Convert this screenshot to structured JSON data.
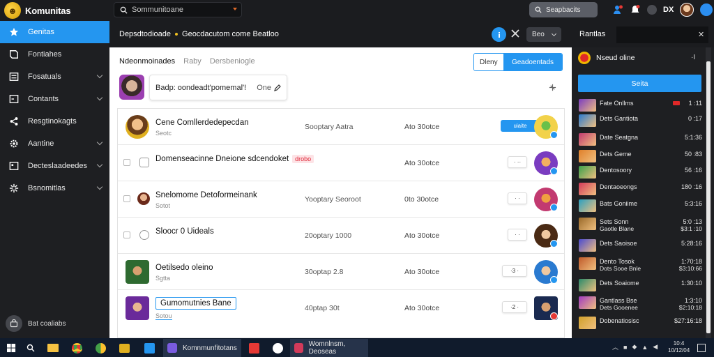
{
  "app": {
    "title": "Komunitas"
  },
  "search": {
    "placeholder": "Sommunitoane"
  },
  "top_search_button": "Seapbacits",
  "top_icons": [
    "profile-alert-icon",
    "notifications-icon",
    "status-dot-icon",
    "dx-label",
    "user-avatar",
    "account-icon"
  ],
  "top_dx": "DX",
  "sidebar": {
    "items": [
      {
        "label": "Genitas",
        "icon": "star-icon",
        "active": true,
        "chevron": false
      },
      {
        "label": "Fontiahes",
        "icon": "book-icon",
        "active": false,
        "chevron": false
      },
      {
        "label": "Fosatuals",
        "icon": "list-icon",
        "active": false,
        "chevron": true
      },
      {
        "label": "Contants",
        "icon": "inbox-icon",
        "active": false,
        "chevron": true
      },
      {
        "label": "Resgtinokagts",
        "icon": "share-icon",
        "active": false,
        "chevron": false
      },
      {
        "label": "Aantine",
        "icon": "gear-icon",
        "active": false,
        "chevron": true
      },
      {
        "label": "Decteslaadeedes",
        "icon": "grid-icon",
        "active": false,
        "chevron": true
      },
      {
        "label": "Bsnomitlas",
        "icon": "puzzle-icon",
        "active": false,
        "chevron": true
      }
    ],
    "footer": {
      "label": "Bat coaliabs",
      "icon": "bag-icon"
    }
  },
  "main_header": {
    "crumb_a": "Depsdtodioade",
    "crumb_b": "Geocdacutom come Beatloo",
    "tools_icon": "tools-icon",
    "dropdown": "Beo"
  },
  "main": {
    "subtabs": [
      "Ndeonmoinades",
      "Raby",
      "Dersbeniogle"
    ],
    "segment": {
      "left": "Dleny",
      "right": "Geadoentads"
    },
    "compose": {
      "text": "Badp: oondeadt'pomemal'!",
      "meta": "One"
    },
    "rows": [
      {
        "title": "Cene Comllerdedepecdan",
        "sub": "Seotc",
        "col2": "Sooptary Aatra",
        "col3": "Ato 30otce",
        "pill": "uiaite",
        "tag": ""
      },
      {
        "title": "Domenseacinne Dneione sdcendoket",
        "sub": "",
        "col2": "",
        "col3": "Ato 30otce",
        "pill": "· ··",
        "tag": "drobo"
      },
      {
        "title": "Snelomome Detoformeinank",
        "sub": "Sotot",
        "col2": "Yooptary Seoroot",
        "col3": "0to 30otce",
        "pill": "· ·",
        "tag": ""
      },
      {
        "title": "Sloocr 0 Uideals",
        "sub": "",
        "col2": "20optary 1000",
        "col3": "Ato 30otce",
        "pill": "· ·",
        "tag": ""
      },
      {
        "title": "Oetilsedo oleino",
        "sub": "Sgtta",
        "col2": "30optap 2.8",
        "col3": "Ato 30otce",
        "pill": "·3 ·",
        "tag": ""
      },
      {
        "title": "Gumomutnies Bane",
        "sub": "Sotou",
        "col2": "40ptap 30t",
        "col3": "Ato 30otce",
        "pill": "·2 ·",
        "tag": ""
      }
    ]
  },
  "right_panel": {
    "title": "Rantlas",
    "online_label": "Nseud oline",
    "online_count": "·I",
    "button": "Seita",
    "items": [
      {
        "name": "Fate Onllms",
        "name2": "",
        "val": "1 :11",
        "val2": "",
        "live": true
      },
      {
        "name": "Dets Gantiota",
        "name2": "",
        "val": "0 :17",
        "val2": "",
        "live": false
      },
      {
        "name": "Date Seatgna",
        "name2": "",
        "val": "5:1:36",
        "val2": "",
        "live": false
      },
      {
        "name": "Dets Geme",
        "name2": "",
        "val": "50 :83",
        "val2": "",
        "live": false
      },
      {
        "name": "Dentosoory",
        "name2": "",
        "val": "56 :16",
        "val2": "",
        "live": false
      },
      {
        "name": "Dentaoeongs",
        "name2": "",
        "val": "180 :16",
        "val2": "",
        "live": false
      },
      {
        "name": "Bats Goniime",
        "name2": "",
        "val": "5:3:16",
        "val2": "",
        "live": false
      },
      {
        "name": "Sets Sonn",
        "name2": "Gaotle Blane",
        "val": "5:0 :13",
        "val2": "$3:1 :10",
        "live": false
      },
      {
        "name": "Dets Saoisoe",
        "name2": "",
        "val": "5:28:16",
        "val2": "",
        "live": false
      },
      {
        "name": "Dento Tosok",
        "name2": "Dots Sooe Bnle",
        "val": "1:70:18",
        "val2": "$3:10:66",
        "live": false
      },
      {
        "name": "Dets Soaiome",
        "name2": "",
        "val": "1:30:10",
        "val2": "",
        "live": false
      },
      {
        "name": "Gantlass Bse",
        "name2": "Dets Gooenee",
        "val": "1:3:10",
        "val2": "$2:10:18",
        "live": false
      },
      {
        "name": "Dobenatiosisc",
        "name2": "",
        "val": "$27:16:18",
        "val2": "",
        "live": false
      }
    ]
  },
  "taskbar": {
    "task1": "Komnmunfitotans",
    "task2": "Womnlnsm, Deoseas",
    "clock_time": "10:4",
    "clock_date": "10/12/04"
  },
  "colors": {
    "accent": "#2496f0",
    "sidebar_bg": "#1e1f22",
    "live_red": "#e02828"
  }
}
